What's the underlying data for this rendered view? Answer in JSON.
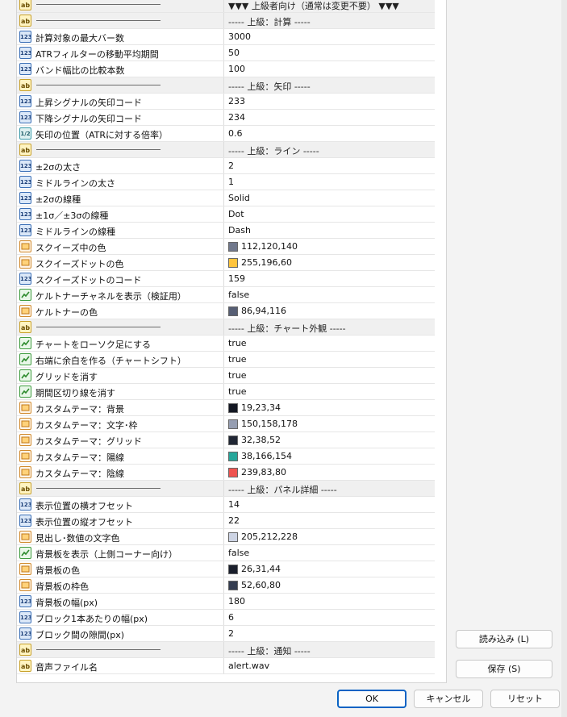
{
  "rows": [
    {
      "kind": "sep",
      "value": "▼▼▼ 上級者向け（通常は変更不要） ▼▼▼"
    },
    {
      "kind": "sep",
      "value": "----- 上級：計算 -----"
    },
    {
      "kind": "int",
      "name": "計算対象の最大バー数",
      "value": "3000"
    },
    {
      "kind": "int",
      "name": "ATRフィルターの移動平均期間",
      "value": "50"
    },
    {
      "kind": "int",
      "name": "バンド幅比の比較本数",
      "value": "100"
    },
    {
      "kind": "sep",
      "value": "----- 上級：矢印 -----"
    },
    {
      "kind": "int",
      "name": "上昇シグナルの矢印コード",
      "value": "233"
    },
    {
      "kind": "int",
      "name": "下降シグナルの矢印コード",
      "value": "234"
    },
    {
      "kind": "dbl",
      "name": "矢印の位置（ATRに対する倍率）",
      "value": "0.6"
    },
    {
      "kind": "sep",
      "value": "----- 上級：ライン -----"
    },
    {
      "kind": "int",
      "name": "±2σの太さ",
      "value": "2"
    },
    {
      "kind": "int",
      "name": "ミドルラインの太さ",
      "value": "1"
    },
    {
      "kind": "int",
      "name": "±2σの線種",
      "value": "Solid"
    },
    {
      "kind": "int",
      "name": "±1σ／±3σの線種",
      "value": "Dot"
    },
    {
      "kind": "int",
      "name": "ミドルラインの線種",
      "value": "Dash"
    },
    {
      "kind": "clr",
      "name": "スクイーズ中の色",
      "value": "112,120,140",
      "swatch": "#70788c"
    },
    {
      "kind": "clr",
      "name": "スクイーズドットの色",
      "value": "255,196,60",
      "swatch": "#ffc43c"
    },
    {
      "kind": "int",
      "name": "スクイーズドットのコード",
      "value": "159"
    },
    {
      "kind": "bool",
      "name": "ケルトナーチャネルを表示（検証用）",
      "value": "false"
    },
    {
      "kind": "clr",
      "name": "ケルトナーの色",
      "value": "86,94,116",
      "swatch": "#565e74"
    },
    {
      "kind": "sep",
      "value": "----- 上級：チャート外観 -----"
    },
    {
      "kind": "bool",
      "name": "チャートをローソク足にする",
      "value": "true"
    },
    {
      "kind": "bool",
      "name": "右端に余白を作る（チャートシフト）",
      "value": "true"
    },
    {
      "kind": "bool",
      "name": "グリッドを消す",
      "value": "true"
    },
    {
      "kind": "bool",
      "name": "期間区切り線を消す",
      "value": "true"
    },
    {
      "kind": "clr",
      "name": "カスタムテーマ：背景",
      "value": "19,23,34",
      "swatch": "#131722"
    },
    {
      "kind": "clr",
      "name": "カスタムテーマ：文字･枠",
      "value": "150,158,178",
      "swatch": "#969eb2"
    },
    {
      "kind": "clr",
      "name": "カスタムテーマ：グリッド",
      "value": "32,38,52",
      "swatch": "#202634"
    },
    {
      "kind": "clr",
      "name": "カスタムテーマ：陽線",
      "value": "38,166,154",
      "swatch": "#26a69a"
    },
    {
      "kind": "clr",
      "name": "カスタムテーマ：陰線",
      "value": "239,83,80",
      "swatch": "#ef5350"
    },
    {
      "kind": "sep",
      "value": "----- 上級：パネル詳細 -----"
    },
    {
      "kind": "int",
      "name": "表示位置の横オフセット",
      "value": "14"
    },
    {
      "kind": "int",
      "name": "表示位置の縦オフセット",
      "value": "22"
    },
    {
      "kind": "clr",
      "name": "見出し･数値の文字色",
      "value": "205,212,228",
      "swatch": "#cdd4e4"
    },
    {
      "kind": "bool",
      "name": "背景板を表示（上側コーナー向け）",
      "value": "false"
    },
    {
      "kind": "clr",
      "name": "背景板の色",
      "value": "26,31,44",
      "swatch": "#1a1f2c"
    },
    {
      "kind": "clr",
      "name": "背景板の枠色",
      "value": "52,60,80",
      "swatch": "#343c50"
    },
    {
      "kind": "int",
      "name": "背景板の幅(px)",
      "value": "180"
    },
    {
      "kind": "int",
      "name": "ブロック1本あたりの幅(px)",
      "value": "6"
    },
    {
      "kind": "int",
      "name": "ブロック間の隙間(px)",
      "value": "2"
    },
    {
      "kind": "sep",
      "value": "----- 上級：通知 -----"
    },
    {
      "kind": "str",
      "name": "音声ファイル名",
      "value": "alert.wav"
    }
  ],
  "icon_labels": {
    "int": "123",
    "dbl": "1/2",
    "str": "ab"
  },
  "buttons": {
    "load": "読み込み (L)",
    "save": "保存 (S)",
    "ok": "OK",
    "cancel": "キャンセル",
    "reset": "リセット"
  },
  "icons": {
    "int": "integer-icon",
    "dbl": "double-icon",
    "str": "string-icon",
    "bool": "boolean-icon",
    "clr": "color-icon"
  }
}
